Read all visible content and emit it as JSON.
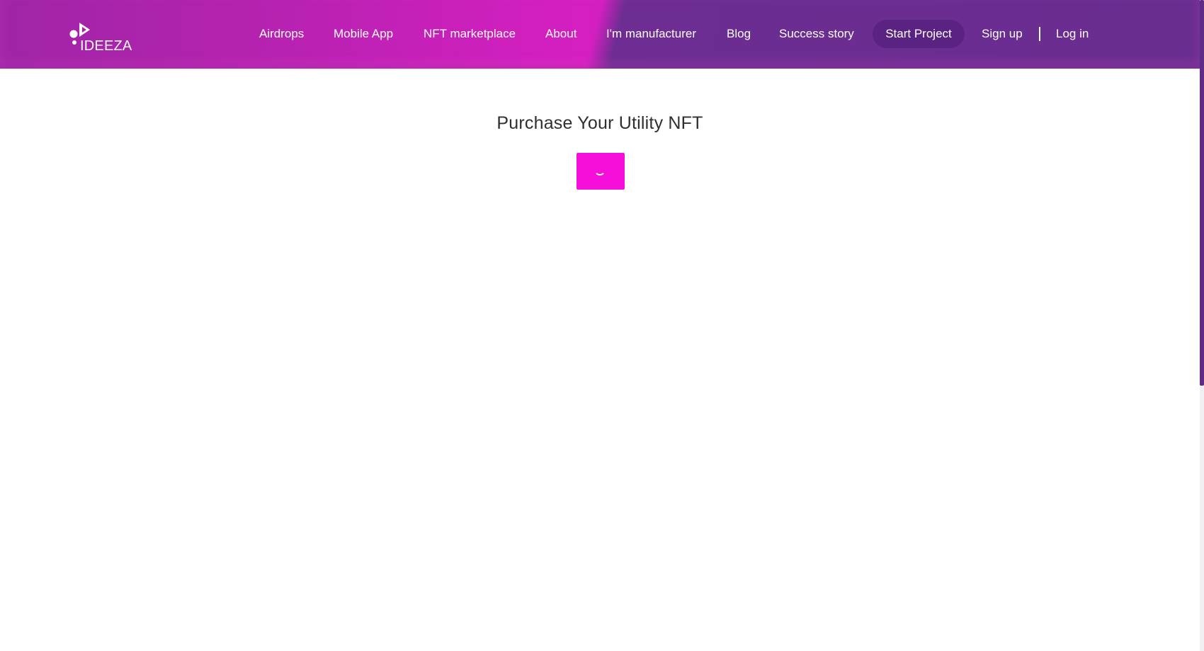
{
  "header": {
    "logo_text": "IDEEZA",
    "nav": [
      {
        "label": "Airdrops"
      },
      {
        "label": "Mobile App"
      },
      {
        "label": "NFT marketplace"
      },
      {
        "label": "About"
      },
      {
        "label": "I'm manufacturer"
      },
      {
        "label": "Blog"
      },
      {
        "label": "Success story"
      }
    ],
    "start_project_label": "Start Project",
    "sign_up_label": "Sign up",
    "log_in_label": "Log in"
  },
  "main": {
    "title": "Purchase Your Utility NFT"
  },
  "colors": {
    "brand_magenta": "#f50fd9",
    "header_purple": "#6d2d92",
    "button_purple": "#5a2381"
  }
}
